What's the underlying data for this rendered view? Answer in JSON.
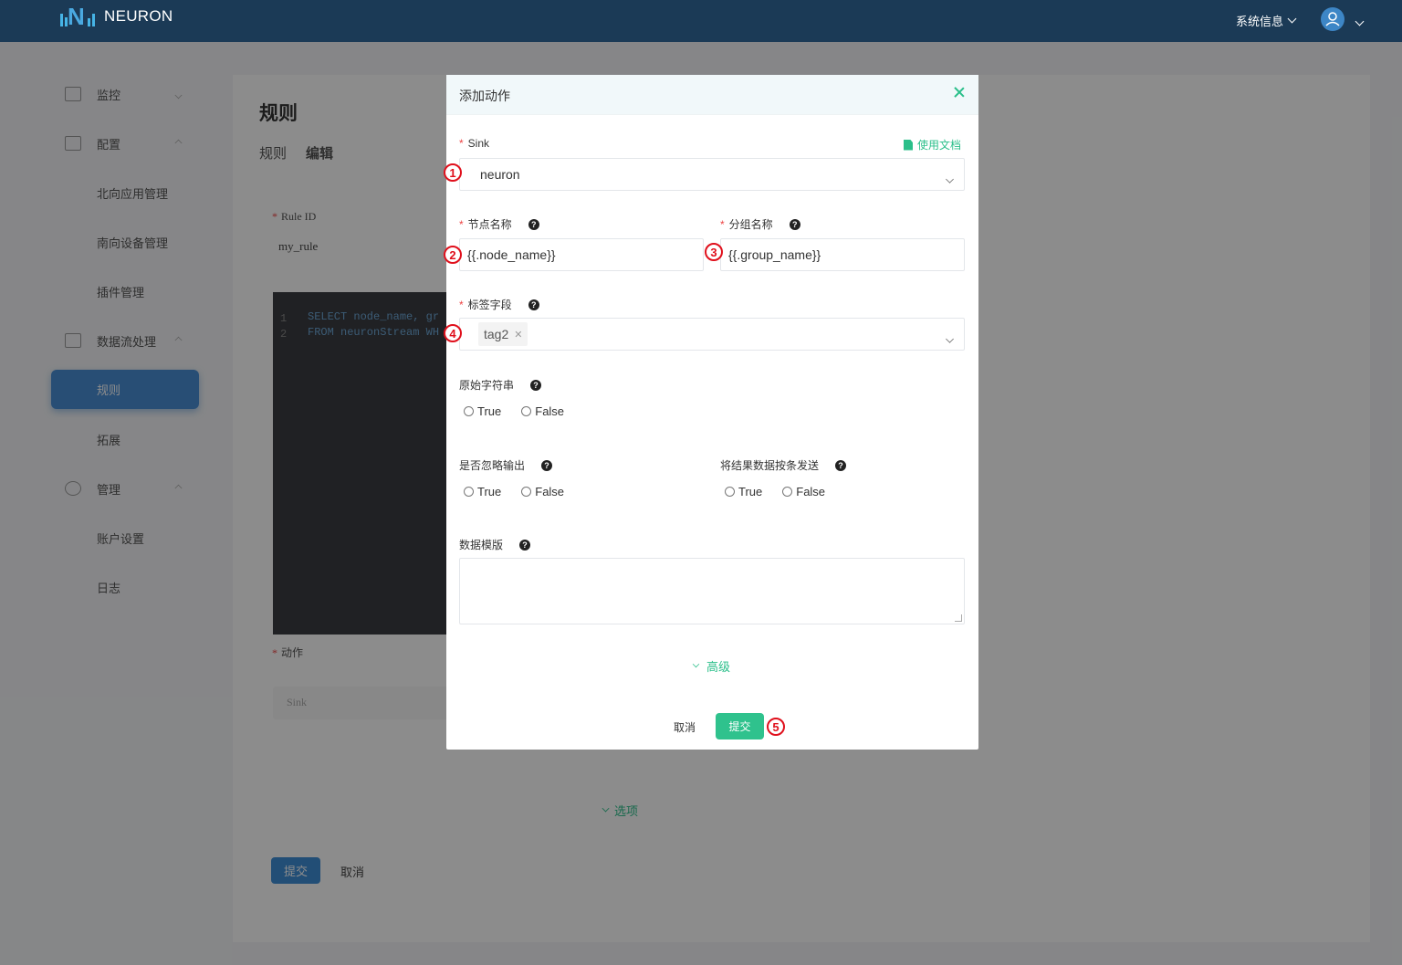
{
  "header": {
    "logo_text": "NEURON",
    "system_info": "系统信息"
  },
  "sidebar": {
    "items": [
      {
        "label": "监控",
        "icon": "monitor-icon"
      },
      {
        "label": "配置",
        "icon": "config-icon"
      },
      {
        "label": "北向应用管理"
      },
      {
        "label": "南向设备管理"
      },
      {
        "label": "插件管理"
      },
      {
        "label": "数据流处理",
        "icon": "dataflow-icon"
      },
      {
        "label": "规则",
        "active": true
      },
      {
        "label": "拓展"
      },
      {
        "label": "管理",
        "icon": "user-icon"
      },
      {
        "label": "账户设置"
      },
      {
        "label": "日志"
      }
    ]
  },
  "page": {
    "title": "规则",
    "breadcrumb": [
      "规则",
      "编辑"
    ],
    "rule_id_label": "Rule ID",
    "rule_id_value": "my_rule",
    "code_lines": [
      "SELECT node_name, gr",
      "FROM neuronStream WH"
    ],
    "action_label": "动作",
    "sink_placeholder": "Sink",
    "options_label": "选项",
    "submit_label": "提交",
    "cancel_label": "取消"
  },
  "modal": {
    "title": "添加动作",
    "sink_label": "Sink",
    "doc_link": "使用文档",
    "sink_value": "neuron",
    "node_name_label": "节点名称",
    "node_name_value": "{{.node_name}}",
    "group_name_label": "分组名称",
    "group_name_value": "{{.group_name}}",
    "tags_label": "标签字段",
    "tag_value": "tag2",
    "raw_string_label": "原始字符串",
    "omit_output_label": "是否忽略输出",
    "send_single_label": "将结果数据按条发送",
    "true_label": "True",
    "false_label": "False",
    "template_label": "数据模版",
    "advanced_label": "高级",
    "cancel_label": "取消",
    "submit_label": "提交"
  },
  "markers": [
    "1",
    "2",
    "3",
    "4",
    "5"
  ],
  "colors": {
    "header_bg": "#1b3a56",
    "accent_green": "#2fc28d",
    "active_blue": "#4a8fd6",
    "marker_red": "#e0101c"
  }
}
